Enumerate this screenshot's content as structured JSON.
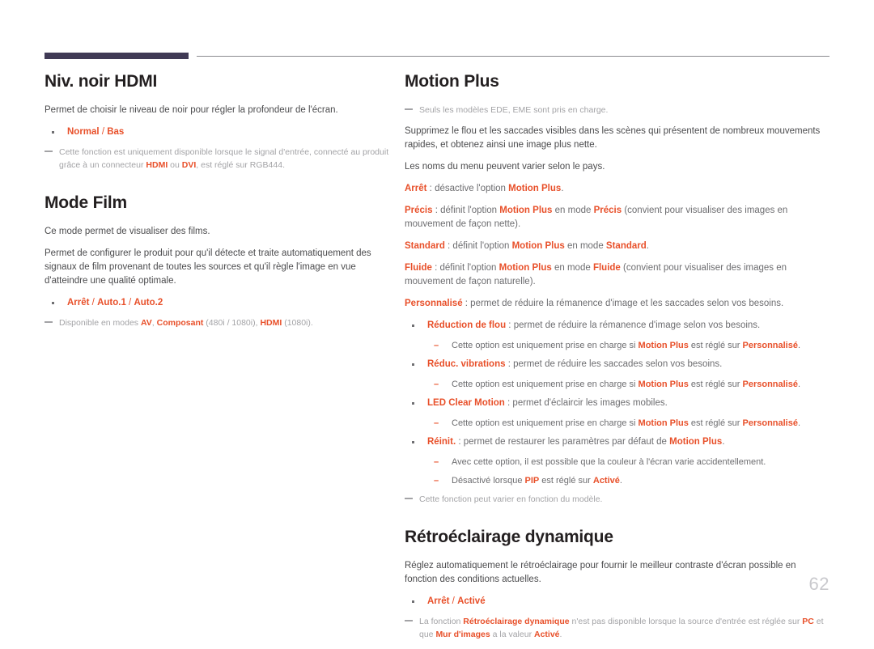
{
  "document": {
    "page_number": "62",
    "accent_color": "#e8502a",
    "rule_color": "#403a55",
    "heading_color": "#231f20",
    "note_color": "#a3a3a6"
  },
  "left_column": {
    "sections": [
      {
        "heading": "Niv. noir HDMI",
        "intro": "Permet de choisir le niveau de noir pour régler la profondeur de l'écran.",
        "option_bullet": {
          "first": "Normal",
          "separator": " / ",
          "second": "Bas"
        },
        "note": {
          "part1": "Cette fonction est uniquement disponible lorsque le signal d'entrée, connecté au produit grâce à un connecteur ",
          "term1": "HDMI",
          "part2": " ou ",
          "term2": "DVI",
          "part3": ", est réglé sur RGB444."
        }
      },
      {
        "heading": "Mode Film",
        "intro1": "Ce mode permet de visualiser des films.",
        "intro2": "Permet de configurer le produit pour qu'il détecte et traite automatiquement des signaux de film provenant de toutes les sources et qu'il règle l'image en vue d'atteindre une qualité optimale.",
        "option_bullet": {
          "first": "Arrêt",
          "sep1": " / ",
          "second": "Auto.1",
          "sep2": " / ",
          "third": "Auto.2"
        },
        "note": {
          "part1": "Disponible en modes ",
          "term1": "AV",
          "part2": ", ",
          "term2": "Composant",
          "part3": " (480i / 1080i), ",
          "term3": "HDMI",
          "part4": " (1080i)."
        }
      }
    ]
  },
  "right_column": {
    "sections": [
      {
        "heading": "Motion Plus",
        "top_note": "Seuls les modèles EDE, EME sont pris en charge.",
        "intro1": "Supprimez le flou et les saccades visibles dans les scènes qui présentent de nombreux mouvements rapides, et obtenez ainsi une image plus nette.",
        "intro2": "Les noms du menu peuvent varier selon le pays.",
        "options": [
          {
            "label": "Arrêt",
            "text_before": " : désactive l'option ",
            "term": "Motion Plus",
            "text_after": "."
          },
          {
            "label": "Précis",
            "text_before": " : définit l'option ",
            "term": "Motion Plus",
            "text_mid": " en mode ",
            "term2": "Précis",
            "text_after": " (convient pour visualiser des images en mouvement de façon nette)."
          },
          {
            "label": "Standard",
            "text_before": " : définit l'option ",
            "term": "Motion Plus",
            "text_mid": " en mode ",
            "term2": "Standard",
            "text_after": "."
          },
          {
            "label": "Fluide",
            "text_before": " : définit l'option ",
            "term": "Motion Plus",
            "text_mid": " en mode ",
            "term2": "Fluide",
            "text_after": " (convient pour visualiser des images en mouvement de façon naturelle)."
          },
          {
            "label": "Personnalisé",
            "text_before": " : permet de réduire la rémanence d'image et les saccades selon vos besoins.",
            "term": "",
            "text_after": ""
          }
        ],
        "sub_items": [
          {
            "label": "Réduction de flou",
            "text": " : permet de réduire la rémanence d'image selon vos besoins.",
            "notes": [
              {
                "part1": "Cette option est uniquement prise en charge si ",
                "term1": "Motion Plus",
                "part2": " est réglé sur ",
                "term2": "Personnalisé",
                "part3": "."
              }
            ]
          },
          {
            "label": "Réduc. vibrations",
            "text": " : permet de réduire les saccades selon vos besoins.",
            "notes": [
              {
                "part1": "Cette option est uniquement prise en charge si ",
                "term1": "Motion Plus",
                "part2": " est réglé sur ",
                "term2": "Personnalisé",
                "part3": "."
              }
            ]
          },
          {
            "label": "LED Clear Motion",
            "text": " : permet d'éclaircir les images mobiles.",
            "notes": [
              {
                "part1": "Cette option est uniquement prise en charge si ",
                "term1": "Motion Plus",
                "part2": " est réglé sur ",
                "term2": "Personnalisé",
                "part3": "."
              }
            ]
          },
          {
            "label": "Réinit.",
            "text": " : permet de restaurer les paramètres par défaut de ",
            "trailing_term": "Motion Plus",
            "trailing_text": ".",
            "notes": [
              {
                "part1": "Avec cette option, il est possible que la couleur à l'écran varie accidentellement.",
                "term1": "",
                "part2": "",
                "term2": "",
                "part3": ""
              },
              {
                "part1": "Désactivé lorsque ",
                "term1": "PIP",
                "part2": " est réglé sur ",
                "term2": "Activé",
                "part3": "."
              }
            ]
          }
        ],
        "bottom_note": "Cette fonction peut varier en fonction du modèle."
      },
      {
        "heading": "Rétroéclairage dynamique",
        "intro": "Réglez automatiquement le rétroéclairage pour fournir le meilleur contraste d'écran possible en fonction des conditions actuelles.",
        "option_bullet": {
          "first": "Arrêt",
          "separator": " / ",
          "second": "Activé"
        },
        "note": {
          "part1": "La fonction ",
          "term1": "Rétroéclairage dynamique",
          "part2": " n'est pas disponible lorsque la source d'entrée est réglée sur ",
          "term2": "PC",
          "part3": " et que ",
          "term3": "Mur d'images",
          "part4": " a la valeur ",
          "term4": "Activé",
          "part5": "."
        }
      }
    ]
  }
}
